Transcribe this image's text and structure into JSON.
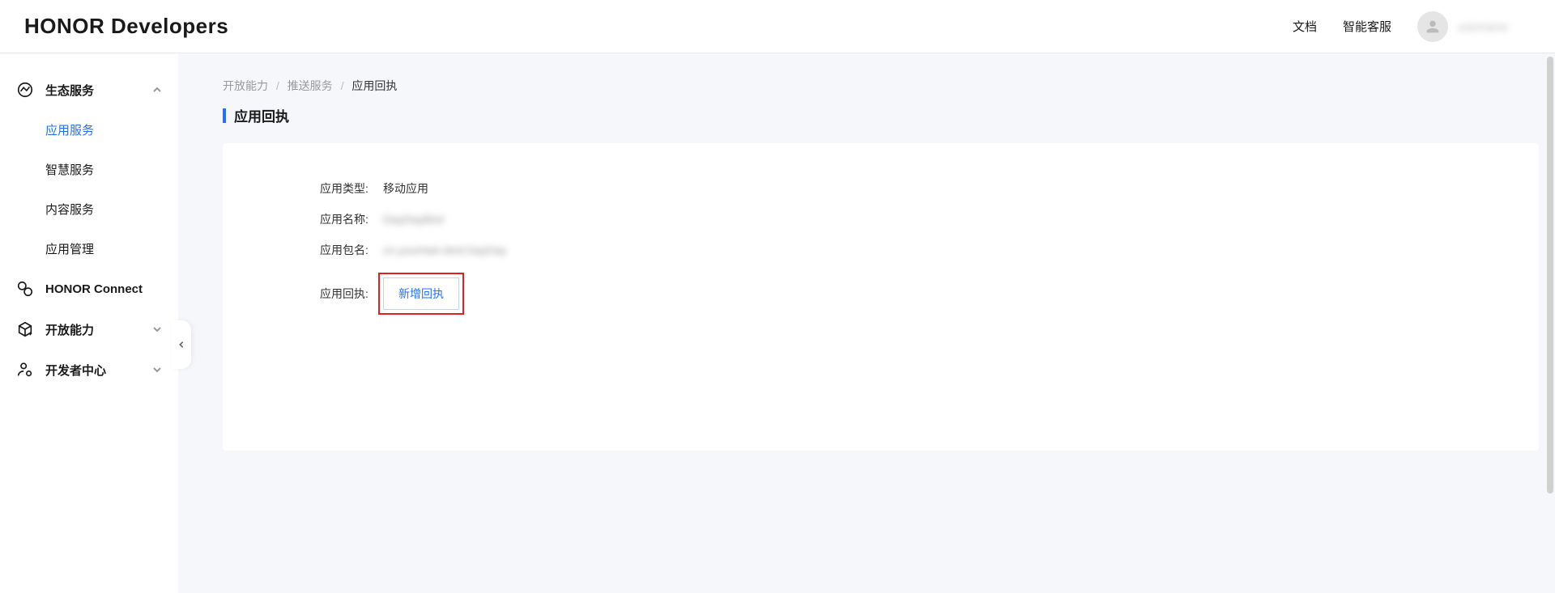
{
  "header": {
    "logo": "HONOR Developers",
    "links": {
      "docs": "文档",
      "support": "智能客服"
    },
    "username": "username"
  },
  "sidebar": {
    "groups": [
      {
        "label": "生态服务",
        "expanded": true,
        "items": [
          {
            "label": "应用服务",
            "active": true
          },
          {
            "label": "智慧服务",
            "active": false
          },
          {
            "label": "内容服务",
            "active": false
          },
          {
            "label": "应用管理",
            "active": false
          }
        ]
      },
      {
        "label": "HONOR Connect",
        "expanded": false
      },
      {
        "label": "开放能力",
        "expanded": false,
        "hasChevron": true
      },
      {
        "label": "开发者中心",
        "expanded": false,
        "hasChevron": true
      }
    ]
  },
  "breadcrumb": {
    "items": [
      "开放能力",
      "推送服务",
      "应用回执"
    ]
  },
  "page": {
    "title": "应用回执",
    "fields": {
      "type_label": "应用类型:",
      "type_value": "移动应用",
      "name_label": "应用名称:",
      "name_value": "DayDayBird",
      "package_label": "应用包名:",
      "package_value": "cn.youmian.bird.DayDay",
      "receipt_label": "应用回执:",
      "add_button": "新增回执"
    }
  }
}
